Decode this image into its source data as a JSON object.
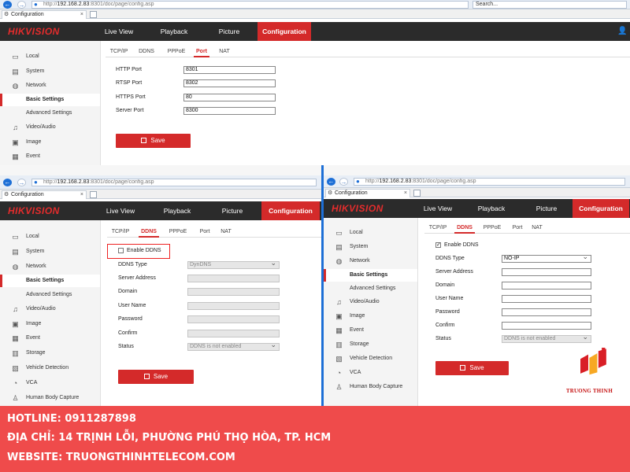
{
  "browser": {
    "url_prefix": "http://",
    "url_host": "192.168.2.83",
    "url_rest": ":8301/doc/page/config.asp",
    "search_placeholder": "Search...",
    "tab_title": "Configuration"
  },
  "app": {
    "logo": "HIKVISION",
    "menu": [
      "Live View",
      "Playback",
      "Picture",
      "Configuration"
    ]
  },
  "panel_top": {
    "sidebar": [
      "Local",
      "System",
      "Network",
      "Basic Settings",
      "Advanced Settings",
      "Video/Audio",
      "Image",
      "Event"
    ],
    "tabs": [
      "TCP/IP",
      "DDNS",
      "PPPoE",
      "Port",
      "NAT"
    ],
    "fields": [
      {
        "label": "HTTP Port",
        "value": "8301"
      },
      {
        "label": "RTSP Port",
        "value": "8302"
      },
      {
        "label": "HTTPS Port",
        "value": "80"
      },
      {
        "label": "Server Port",
        "value": "8300"
      }
    ],
    "save": "Save"
  },
  "panel_left": {
    "sidebar": [
      "Local",
      "System",
      "Network",
      "Basic Settings",
      "Advanced Settings",
      "Video/Audio",
      "Image",
      "Event",
      "Storage",
      "Vehicle Detection",
      "VCA",
      "Human Body Capture"
    ],
    "tabs": [
      "TCP/IP",
      "DDNS",
      "PPPoE",
      "Port",
      "NAT"
    ],
    "enable_label": "Enable DDNS",
    "fields": [
      {
        "label": "DDNS Type",
        "value": "DynDNS"
      },
      {
        "label": "Server Address",
        "value": ""
      },
      {
        "label": "Domain",
        "value": ""
      },
      {
        "label": "User Name",
        "value": ""
      },
      {
        "label": "Password",
        "value": ""
      },
      {
        "label": "Confirm",
        "value": ""
      },
      {
        "label": "Status",
        "value": "DDNS is not enabled"
      }
    ],
    "save": "Save"
  },
  "panel_right": {
    "sidebar": [
      "Local",
      "System",
      "Network",
      "Basic Settings",
      "Advanced Settings",
      "Video/Audio",
      "Image",
      "Event",
      "Storage",
      "Vehicle Detection",
      "VCA",
      "Human Body Capture"
    ],
    "tabs": [
      "TCP/IP",
      "DDNS",
      "PPPoE",
      "Port",
      "NAT"
    ],
    "enable_label": "Enable DDNS",
    "fields": [
      {
        "label": "DDNS Type",
        "value": "NO-IP"
      },
      {
        "label": "Server Address",
        "value": ""
      },
      {
        "label": "Domain",
        "value": ""
      },
      {
        "label": "User Name",
        "value": ""
      },
      {
        "label": "Password",
        "value": ""
      },
      {
        "label": "Confirm",
        "value": ""
      },
      {
        "label": "Status",
        "value": "DDNS is not enabled"
      }
    ],
    "save": "Save"
  },
  "banner": {
    "hotline": "HOTLINE: 0911287898",
    "address": "ĐỊA CHỈ: 14 TRỊNH LỖI, PHƯỜNG PHÚ THỌ HÒA, TP. HCM",
    "website": "WEBSITE: TRUONGTHINHTELECOM.COM"
  },
  "brand": {
    "name": "TRUONG THINH"
  },
  "colors": {
    "accent": "#d42a2a",
    "banner": "#ef4b4b",
    "header": "#2b2b2b"
  }
}
